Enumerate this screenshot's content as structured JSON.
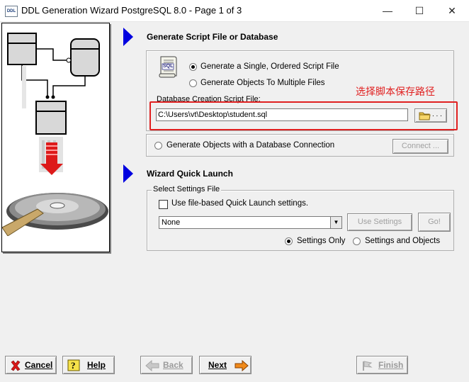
{
  "window": {
    "title": "DDL Generation Wizard PostgreSQL 8.0 - Page 1 of 3",
    "app_icon_text": "DDL",
    "controls": {
      "minimize": "—",
      "maximize": "☐",
      "close": "✕"
    }
  },
  "section_generate": {
    "title": "Generate Script File or Database",
    "sql_icon_text": "SQL",
    "option_single": "Generate a Single, Ordered Script File",
    "option_multiple": "Generate Objects To Multiple Files",
    "script_file_label": "Database Creation Script File:",
    "script_file_value": "C:\\Users\\vt\\Desktop\\student.sql",
    "browse_label": ". . .",
    "option_db_connection": "Generate Objects with a Database Connection",
    "connect_button": "Connect ...",
    "annotation": "选择脚本保存路径",
    "selected_option": "single"
  },
  "section_quick_launch": {
    "title": "Wizard Quick Launch",
    "group_label": "Select Settings File",
    "use_file_checkbox": "Use file-based Quick Launch settings.",
    "use_file_checked": false,
    "settings_select_value": "None",
    "use_settings_button": "Use Settings",
    "go_button": "Go!",
    "radio_settings_only": "Settings Only",
    "radio_settings_objects": "Settings and Objects",
    "selected_radio": "settings_only"
  },
  "footer": {
    "cancel": "Cancel",
    "help": "Help",
    "back": "Back",
    "next": "Next",
    "finish": "Finish"
  },
  "colors": {
    "accent_arrow": "#0000e0",
    "annotation": "#e02020"
  }
}
